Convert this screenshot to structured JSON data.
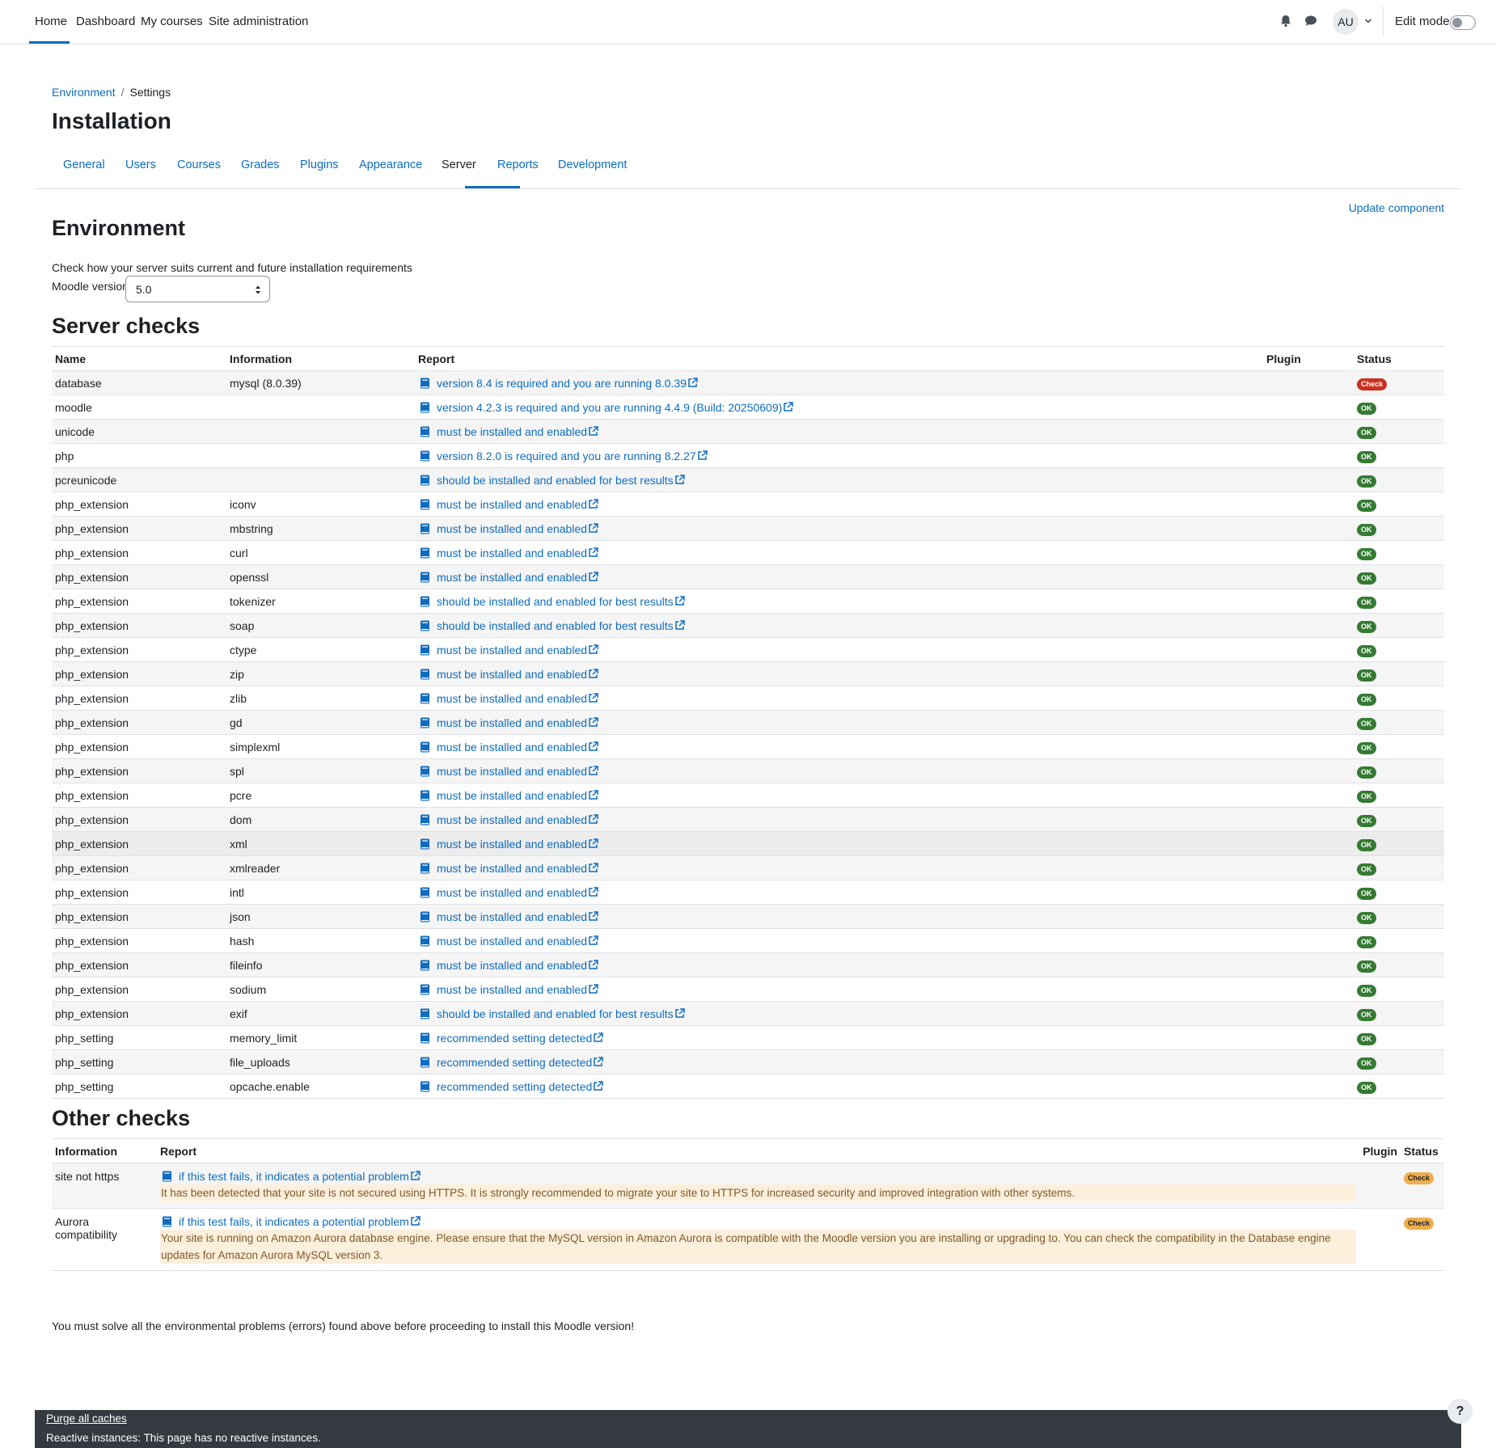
{
  "nav": {
    "home": "Home",
    "dashboard": "Dashboard",
    "my_courses": "My courses",
    "site_admin": "Site administration",
    "avatar_initials": "AU",
    "edit_mode": "Edit mode"
  },
  "breadcrumb": {
    "first": "Environment",
    "sep": "/",
    "second": "Settings"
  },
  "page_title": "Installation",
  "tabs": [
    "General",
    "Users",
    "Courses",
    "Grades",
    "Plugins",
    "Appearance",
    "Server",
    "Reports",
    "Development"
  ],
  "active_tab": "Server",
  "update_component": "Update component",
  "environment": {
    "title": "Environment",
    "description": "Check how your server suits current and future installation requirements",
    "version_label": "Moodle version",
    "version_value": "5.0"
  },
  "server_checks": {
    "title": "Server checks",
    "headers": {
      "name": "Name",
      "information": "Information",
      "report": "Report",
      "plugin": "Plugin",
      "status": "Status"
    },
    "rows": [
      {
        "name": "database",
        "info": "mysql (8.0.39)",
        "report": "version 8.4 is required and you are running 8.0.39",
        "status": "Check",
        "level": "err"
      },
      {
        "name": "moodle",
        "info": "",
        "report": "version 4.2.3 is required and you are running 4.4.9 (Build: 20250609)",
        "status": "OK",
        "level": "ok"
      },
      {
        "name": "unicode",
        "info": "",
        "report": "must be installed and enabled",
        "status": "OK",
        "level": "ok"
      },
      {
        "name": "php",
        "info": "",
        "report": "version 8.2.0 is required and you are running 8.2.27",
        "status": "OK",
        "level": "ok"
      },
      {
        "name": "pcreunicode",
        "info": "",
        "report": "should be installed and enabled for best results",
        "status": "OK",
        "level": "ok"
      },
      {
        "name": "php_extension",
        "info": "iconv",
        "report": "must be installed and enabled",
        "status": "OK",
        "level": "ok"
      },
      {
        "name": "php_extension",
        "info": "mbstring",
        "report": "must be installed and enabled",
        "status": "OK",
        "level": "ok"
      },
      {
        "name": "php_extension",
        "info": "curl",
        "report": "must be installed and enabled",
        "status": "OK",
        "level": "ok"
      },
      {
        "name": "php_extension",
        "info": "openssl",
        "report": "must be installed and enabled",
        "status": "OK",
        "level": "ok"
      },
      {
        "name": "php_extension",
        "info": "tokenizer",
        "report": "should be installed and enabled for best results",
        "status": "OK",
        "level": "ok"
      },
      {
        "name": "php_extension",
        "info": "soap",
        "report": "should be installed and enabled for best results",
        "status": "OK",
        "level": "ok"
      },
      {
        "name": "php_extension",
        "info": "ctype",
        "report": "must be installed and enabled",
        "status": "OK",
        "level": "ok"
      },
      {
        "name": "php_extension",
        "info": "zip",
        "report": "must be installed and enabled",
        "status": "OK",
        "level": "ok"
      },
      {
        "name": "php_extension",
        "info": "zlib",
        "report": "must be installed and enabled",
        "status": "OK",
        "level": "ok"
      },
      {
        "name": "php_extension",
        "info": "gd",
        "report": "must be installed and enabled",
        "status": "OK",
        "level": "ok"
      },
      {
        "name": "php_extension",
        "info": "simplexml",
        "report": "must be installed and enabled",
        "status": "OK",
        "level": "ok"
      },
      {
        "name": "php_extension",
        "info": "spl",
        "report": "must be installed and enabled",
        "status": "OK",
        "level": "ok"
      },
      {
        "name": "php_extension",
        "info": "pcre",
        "report": "must be installed and enabled",
        "status": "OK",
        "level": "ok"
      },
      {
        "name": "php_extension",
        "info": "dom",
        "report": "must be installed and enabled",
        "status": "OK",
        "level": "ok"
      },
      {
        "name": "php_extension",
        "info": "xml",
        "report": "must be installed and enabled",
        "status": "OK",
        "level": "ok"
      },
      {
        "name": "php_extension",
        "info": "xmlreader",
        "report": "must be installed and enabled",
        "status": "OK",
        "level": "ok"
      },
      {
        "name": "php_extension",
        "info": "intl",
        "report": "must be installed and enabled",
        "status": "OK",
        "level": "ok"
      },
      {
        "name": "php_extension",
        "info": "json",
        "report": "must be installed and enabled",
        "status": "OK",
        "level": "ok"
      },
      {
        "name": "php_extension",
        "info": "hash",
        "report": "must be installed and enabled",
        "status": "OK",
        "level": "ok"
      },
      {
        "name": "php_extension",
        "info": "fileinfo",
        "report": "must be installed and enabled",
        "status": "OK",
        "level": "ok"
      },
      {
        "name": "php_extension",
        "info": "sodium",
        "report": "must be installed and enabled",
        "status": "OK",
        "level": "ok"
      },
      {
        "name": "php_extension",
        "info": "exif",
        "report": "should be installed and enabled for best results",
        "status": "OK",
        "level": "ok"
      },
      {
        "name": "php_setting",
        "info": "memory_limit",
        "report": "recommended setting detected",
        "status": "OK",
        "level": "ok"
      },
      {
        "name": "php_setting",
        "info": "file_uploads",
        "report": "recommended setting detected",
        "status": "OK",
        "level": "ok"
      },
      {
        "name": "php_setting",
        "info": "opcache.enable",
        "report": "recommended setting detected",
        "status": "OK",
        "level": "ok"
      }
    ]
  },
  "other_checks": {
    "title": "Other checks",
    "headers": {
      "information": "Information",
      "report": "Report",
      "plugin": "Plugin",
      "status": "Status"
    },
    "rows": [
      {
        "info": "site not https",
        "report": "if this test fails, it indicates a potential problem",
        "message": "It has been detected that your site is not secured using HTTPS. It is strongly recommended to migrate your site to HTTPS for increased security and improved integration with other systems.",
        "status": "Check"
      },
      {
        "info": "Aurora compatibility",
        "report": "if this test fails, it indicates a potential problem",
        "message": "Your site is running on Amazon Aurora database engine. Please ensure that the MySQL version in Amazon Aurora is compatible with the Moodle version you are installing or upgrading to. You can check the compatibility in the Database engine updates for Amazon Aurora MySQL version 3.",
        "status": "Check"
      }
    ]
  },
  "final_note": "You must solve all the environmental problems (errors) found above before proceeding to install this Moodle version!",
  "footer": {
    "purge": "Purge all caches",
    "reactive": "Reactive instances: This page has no reactive instances."
  },
  "help_button": "?",
  "colors": {
    "link": "#0f6cbf",
    "ok": "#357a32",
    "error": "#ca3120",
    "warning": "#f0ad4e",
    "footer_bg": "#343a40"
  }
}
